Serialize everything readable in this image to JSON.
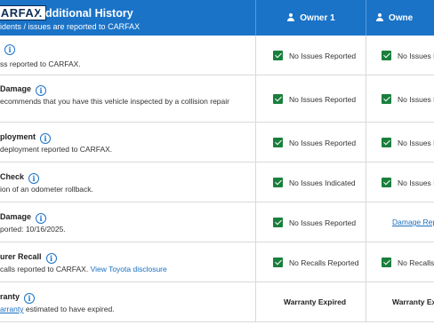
{
  "header": {
    "logo": "CARFAX",
    "title": "Additional History",
    "subtitle": "idents / issues are reported to CARFAX",
    "owner1": "Owner 1",
    "owner2": "Owne"
  },
  "rows": [
    {
      "title": "",
      "desc": "ss reported to CARFAX.",
      "o1": "No Issues Reported",
      "o2": "No Issues R"
    },
    {
      "title": "Damage",
      "desc": "ecommends that you have this vehicle inspected by a collision repair",
      "o1": "No Issues Reported",
      "o2": "No Issues R"
    },
    {
      "title": "ployment",
      "desc": "deployment reported to CARFAX.",
      "o1": "No Issues Reported",
      "o2": "No Issues R"
    },
    {
      "title": "Check",
      "desc": "ion of an odometer rollback.",
      "o1": "No Issues Indicated",
      "o2": "No Issues In"
    },
    {
      "title": "Damage",
      "desc": "ported: 10/16/2025.",
      "o1": "No Issues Reported",
      "o2": "Damage Repo"
    },
    {
      "title": "urer Recall",
      "desc": "calls reported to CARFAX.",
      "desc_link": "View Toyota disclosure",
      "o1": "No Recalls Reported",
      "o2": "No Recalls R"
    },
    {
      "title": "ranty",
      "desc_link_u": "arranty",
      "desc_after": "estimated to have expired.",
      "o1": "Warranty Expired",
      "o2": "Warranty Exp"
    }
  ],
  "icons": {
    "info": "info-icon",
    "check": "checkmark-icon",
    "owner": "person-icon"
  },
  "colors": {
    "header_bg": "#1a73c7",
    "check": "#1a7f3c",
    "link": "#1a6fc0"
  }
}
